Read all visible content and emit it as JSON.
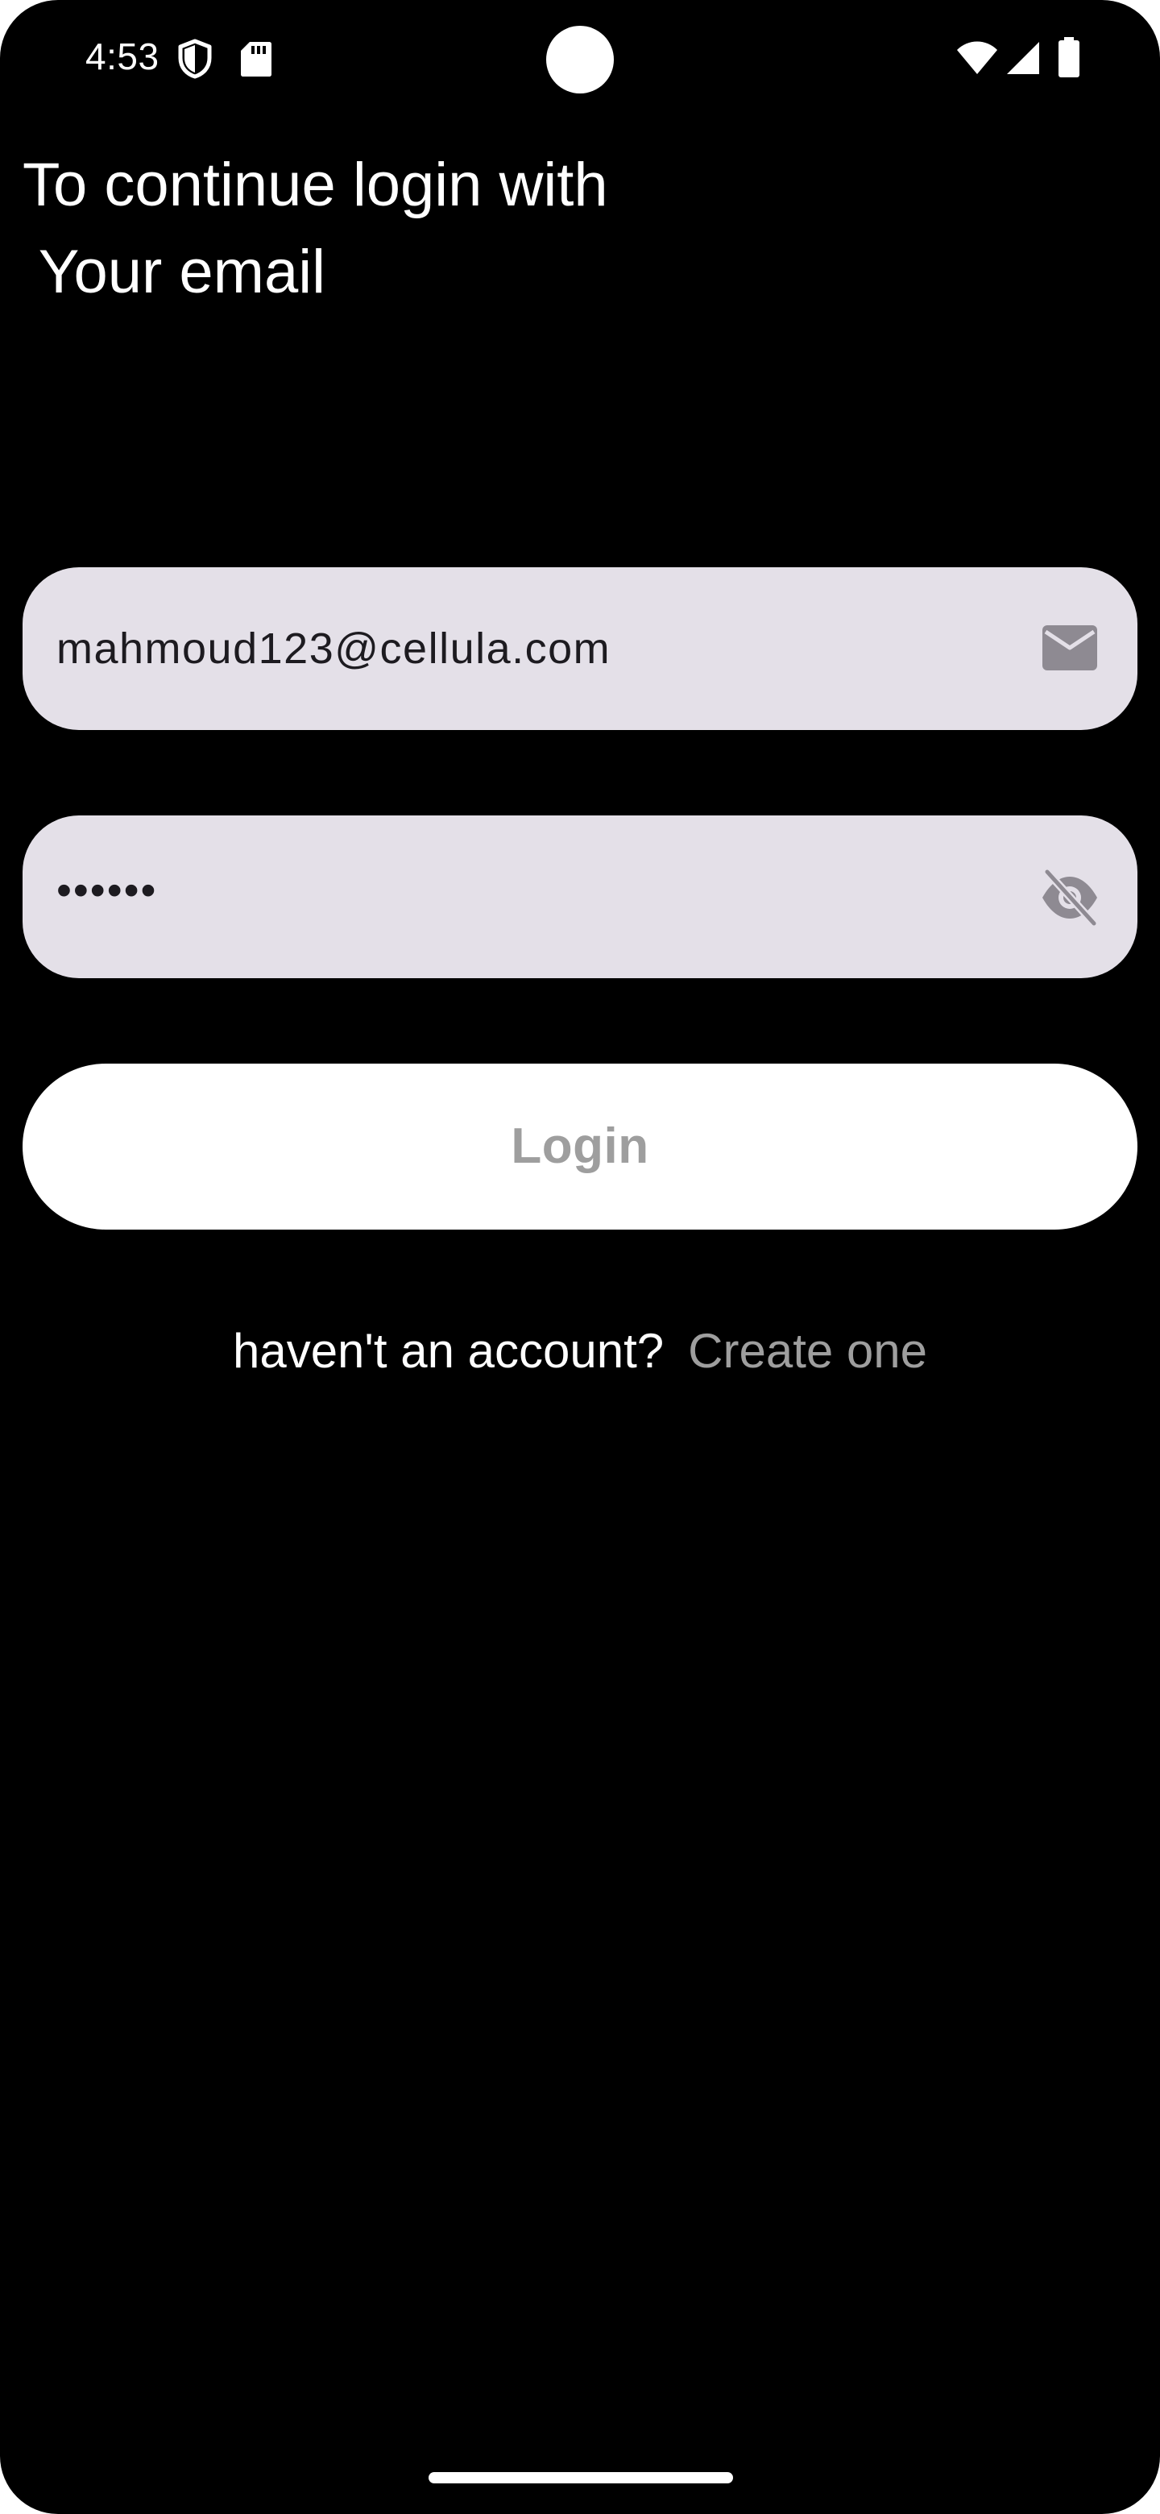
{
  "status_bar": {
    "time": "4:53",
    "icons": [
      "shield-icon",
      "sd-card-icon",
      "wifi-icon",
      "signal-icon",
      "battery-icon"
    ]
  },
  "heading": {
    "line1": "To continue login with",
    "line2": " Your email"
  },
  "email_field": {
    "value": "mahmoud123@cellula.com",
    "icon": "mail-icon"
  },
  "password_field": {
    "value": "••••••",
    "icon": "eye-off-icon"
  },
  "login_button": {
    "label": "Login"
  },
  "signup": {
    "prompt": "haven't an account?",
    "link": "Create one"
  },
  "colors": {
    "background": "#000000",
    "field_background": "#e4e0e8",
    "button_background": "#ffffff",
    "muted_text": "#9e9e9e",
    "text_white": "#ffffff"
  }
}
